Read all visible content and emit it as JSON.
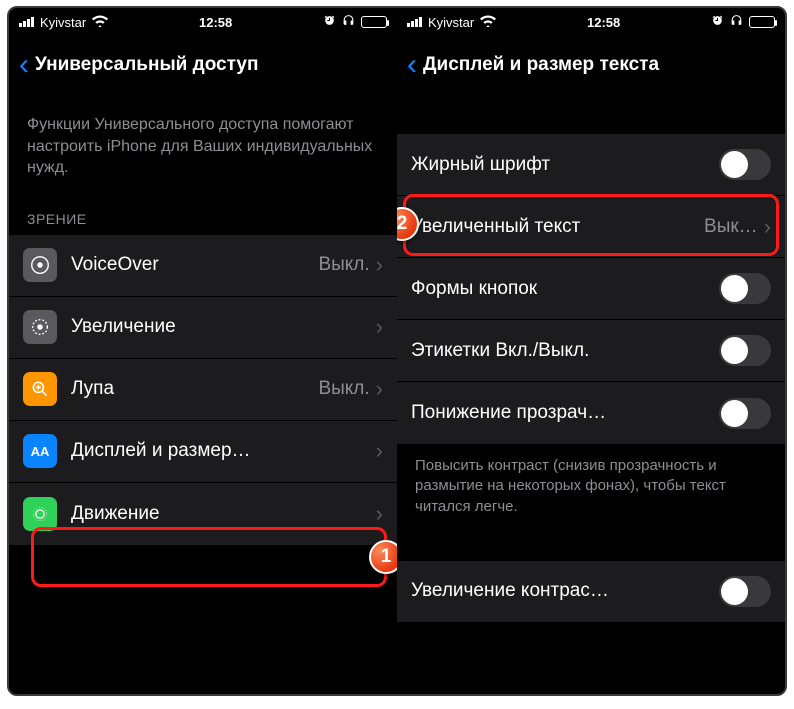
{
  "statusbar": {
    "carrier": "Kyivstar",
    "time": "12:58"
  },
  "left": {
    "nav_title": "Универсальный доступ",
    "intro": "Функции Универсального доступа помогают настроить iPhone для Ваших индивидуальных нужд.",
    "section": "ЗРЕНИЕ",
    "rows": [
      {
        "label": "VoiceOver",
        "value": "Выкл."
      },
      {
        "label": "Увеличение",
        "value": ""
      },
      {
        "label": "Лупа",
        "value": "Выкл."
      },
      {
        "label": "Дисплей и размер…",
        "value": ""
      },
      {
        "label": "Движение",
        "value": ""
      }
    ]
  },
  "right": {
    "nav_title": "Дисплей и размер текста",
    "rows": [
      {
        "label": "Жирный шрифт"
      },
      {
        "label": "Увеличенный текст",
        "value": "Вык…"
      },
      {
        "label": "Формы кнопок"
      },
      {
        "label": "Этикетки Вкл./Выкл."
      },
      {
        "label": "Понижение прозрач…"
      }
    ],
    "footer": "Повысить контраст (снизив прозрачность и размытие на некоторых фонах), чтобы текст читался легче.",
    "rows2": [
      {
        "label": "Увеличение контрас…"
      }
    ]
  },
  "badges": {
    "one": "1",
    "two": "2"
  },
  "icons": {
    "voiceover_bg": "#5a5a5e",
    "zoom_bg": "#5a5a5e",
    "lupa_bg": "#ff9500",
    "display_bg": "#0a84ff",
    "motion_bg": "#30d158"
  }
}
